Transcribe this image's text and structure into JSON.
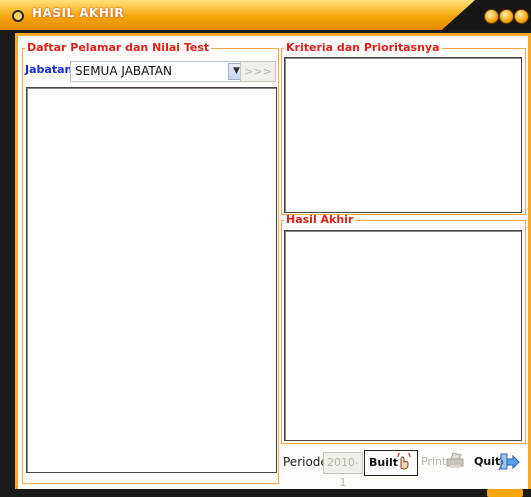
{
  "window": {
    "title": "HASIL AKHIR"
  },
  "left_panel": {
    "legend": "Daftar Pelamar dan Nilai Test",
    "jabatan_label": "Jabatan",
    "jabatan_value": "SEMUA JABATAN",
    "go_button": ">>>"
  },
  "criteria_panel": {
    "legend": "Kriteria dan Prioritasnya"
  },
  "result_panel": {
    "legend": "Hasil Akhir"
  },
  "footer": {
    "periode_label": "Periode",
    "periode_value": "2010-1",
    "built_label": "Built",
    "print_label": "Print",
    "quit_label": "Quit"
  },
  "colors": {
    "accent": "#f6a60b",
    "legend_red": "#e0201b",
    "label_blue": "#1a2ad8"
  }
}
